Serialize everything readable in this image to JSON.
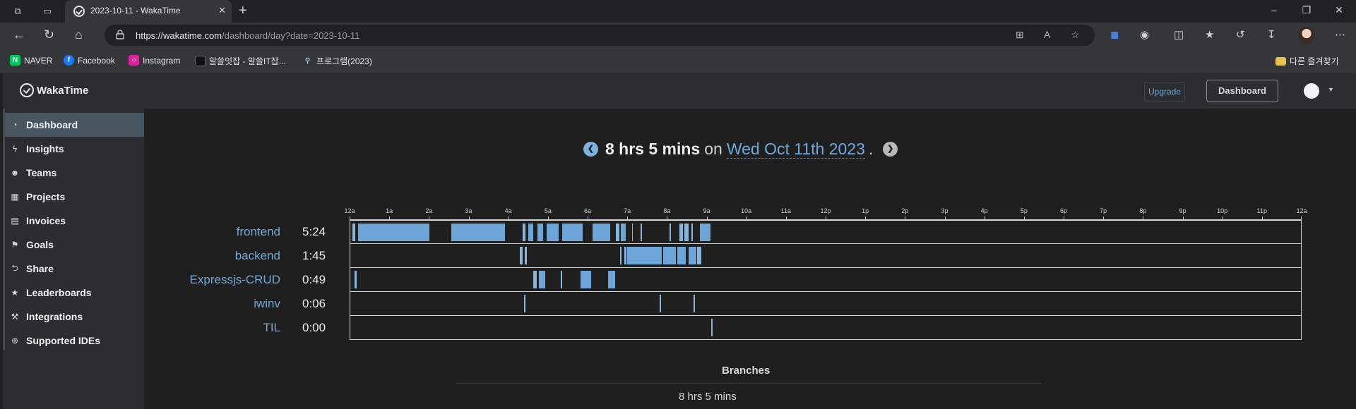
{
  "browser": {
    "tab_title": "2023-10-11 - WakaTime",
    "url_host": "https://wakatime.com",
    "url_path": "/dashboard/day?date=2023-10-11",
    "bookmarks": [
      {
        "label": "NAVER",
        "icon": "naver-icon",
        "color": "#03c75a"
      },
      {
        "label": "Facebook",
        "icon": "facebook-icon",
        "color": "#1877f2"
      },
      {
        "label": "Instagram",
        "icon": "instagram-icon",
        "color": "#d6249f"
      },
      {
        "label": "알쓸잇잡 - 알쓸IT잡...",
        "icon": "site-icon",
        "color": "#111111"
      },
      {
        "label": "프로그램(2023)",
        "icon": "search-icon",
        "color": "#6aa0d8"
      }
    ],
    "other_bookmarks": "다른 즐겨찾기"
  },
  "app": {
    "brand": "WakaTime",
    "upgrade_label": "Upgrade",
    "dashboard_label": "Dashboard",
    "accent_color": "#6fa8dc"
  },
  "sidebar": {
    "items": [
      {
        "label": "Dashboard",
        "icon": "gauge-icon",
        "active": true
      },
      {
        "label": "Insights",
        "icon": "bolt-icon",
        "active": false
      },
      {
        "label": "Teams",
        "icon": "users-icon",
        "active": false
      },
      {
        "label": "Projects",
        "icon": "grid-icon",
        "active": false
      },
      {
        "label": "Invoices",
        "icon": "file-icon",
        "active": false
      },
      {
        "label": "Goals",
        "icon": "flag-icon",
        "active": false
      },
      {
        "label": "Share",
        "icon": "share-icon",
        "active": false
      },
      {
        "label": "Leaderboards",
        "icon": "trophy-icon",
        "active": false
      },
      {
        "label": "Integrations",
        "icon": "wrench-icon",
        "active": false
      },
      {
        "label": "Supported IDEs",
        "icon": "plus-circle-icon",
        "active": false
      }
    ]
  },
  "summary": {
    "total": "8 hrs 5 mins",
    "on": "on",
    "date": "Wed Oct 11th 2023",
    "period": "."
  },
  "timeline": {
    "ticks": [
      "12a",
      "1a",
      "2a",
      "3a",
      "4a",
      "5a",
      "6a",
      "7a",
      "8a",
      "9a",
      "10a",
      "11a",
      "12p",
      "1p",
      "2p",
      "3p",
      "4p",
      "5p",
      "6p",
      "7p",
      "8p",
      "9p",
      "10p",
      "11p",
      "12a"
    ],
    "projects": [
      {
        "name": "frontend",
        "time": "5:24",
        "activity_hours": [
          [
            0.05,
            0.12
          ],
          [
            0.2,
            2.0
          ],
          [
            2.55,
            3.9
          ],
          [
            4.35,
            4.42
          ],
          [
            4.48,
            4.62
          ],
          [
            4.72,
            4.86
          ],
          [
            4.95,
            5.25
          ],
          [
            5.35,
            5.85
          ],
          [
            6.1,
            6.55
          ],
          [
            6.7,
            6.78
          ],
          [
            6.82,
            6.95
          ],
          [
            7.1,
            7.13
          ],
          [
            7.32,
            7.36
          ],
          [
            8.05,
            8.08
          ],
          [
            8.3,
            8.38
          ],
          [
            8.42,
            8.52
          ],
          [
            8.6,
            8.64
          ],
          [
            8.82,
            9.08
          ]
        ]
      },
      {
        "name": "backend",
        "time": "1:45",
        "activity_hours": [
          [
            4.28,
            4.34
          ],
          [
            4.4,
            4.46
          ],
          [
            6.8,
            6.83
          ],
          [
            6.9,
            6.96
          ],
          [
            6.98,
            7.85
          ],
          [
            7.88,
            8.2
          ],
          [
            8.24,
            8.45
          ],
          [
            8.52,
            8.72
          ],
          [
            8.75,
            8.85
          ]
        ]
      },
      {
        "name": "Expressjs-CRUD",
        "time": "0:49",
        "activity_hours": [
          [
            0.1,
            0.16
          ],
          [
            4.62,
            4.7
          ],
          [
            4.75,
            4.92
          ],
          [
            5.3,
            5.34
          ],
          [
            5.8,
            6.08
          ],
          [
            6.5,
            6.68
          ]
        ]
      },
      {
        "name": "iwinv",
        "time": "0:06",
        "activity_hours": [
          [
            4.38,
            4.41
          ],
          [
            7.8,
            7.84
          ],
          [
            8.65,
            8.68
          ]
        ]
      },
      {
        "name": "TIL",
        "time": "0:00",
        "activity_hours": [
          [
            9.1,
            9.12
          ]
        ]
      }
    ]
  },
  "branches": {
    "title": "Branches",
    "total": "8 hrs 5 mins"
  }
}
